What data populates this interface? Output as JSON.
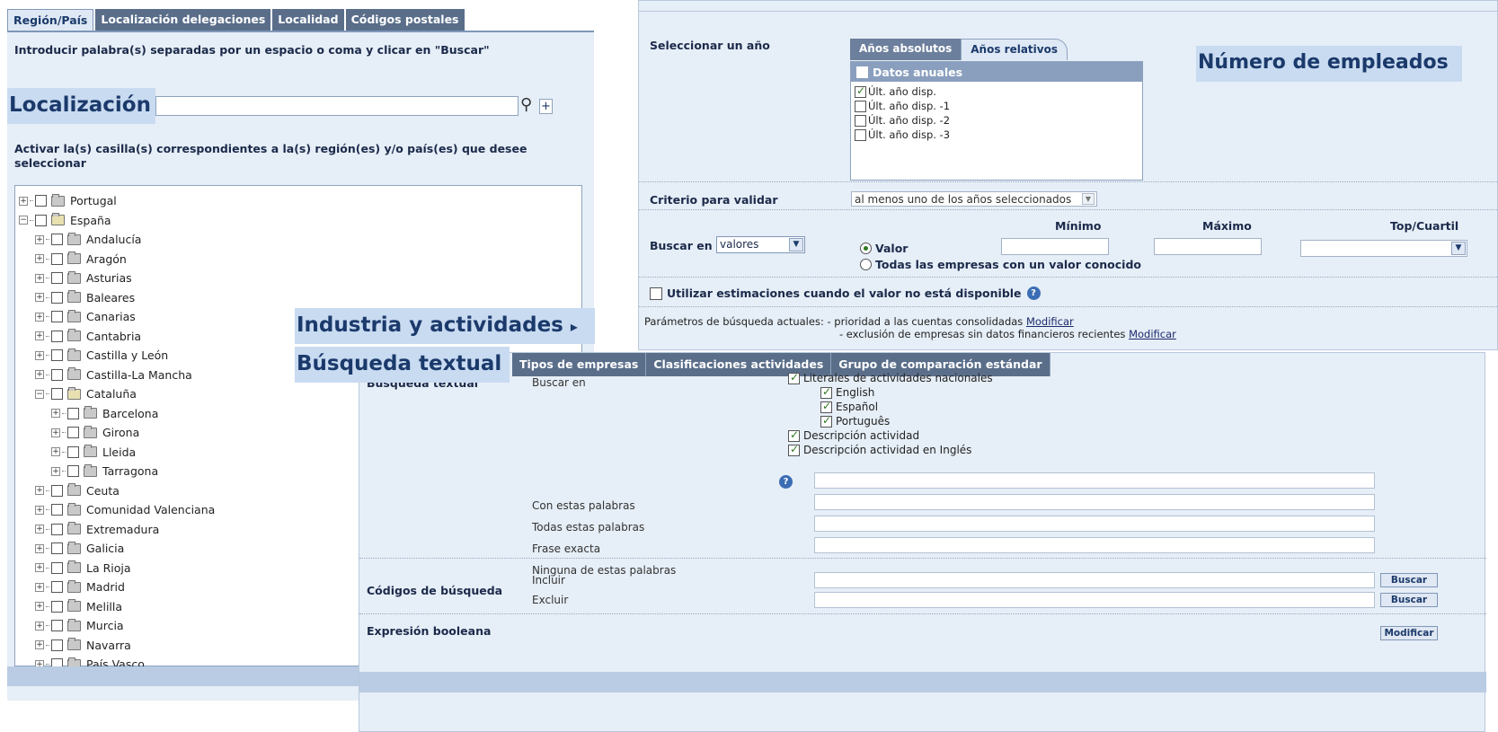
{
  "left": {
    "tabs": [
      "Región/País",
      "Localización delegaciones",
      "Localidad",
      "Códigos postales"
    ],
    "intro": "Introducir palabra(s) separadas por un espacio o coma y clicar en \"Buscar\"",
    "loc_label": "Localización",
    "plus_label": "+",
    "activar": "Activar la(s) casilla(s) correspondientes a la(s) región(es) y/o país(es) que desee seleccionar",
    "tree": [
      {
        "label": "Portugal",
        "level": 0,
        "open": false
      },
      {
        "label": "España",
        "level": 0,
        "open": true
      },
      {
        "label": "Andalucía",
        "level": 1,
        "open": false
      },
      {
        "label": "Aragón",
        "level": 1,
        "open": false
      },
      {
        "label": "Asturias",
        "level": 1,
        "open": false
      },
      {
        "label": "Baleares",
        "level": 1,
        "open": false
      },
      {
        "label": "Canarias",
        "level": 1,
        "open": false
      },
      {
        "label": "Cantabria",
        "level": 1,
        "open": false
      },
      {
        "label": "Castilla y León",
        "level": 1,
        "open": false
      },
      {
        "label": "Castilla-La Mancha",
        "level": 1,
        "open": false
      },
      {
        "label": "Cataluña",
        "level": 1,
        "open": true
      },
      {
        "label": "Barcelona",
        "level": 2,
        "open": false
      },
      {
        "label": "Girona",
        "level": 2,
        "open": false
      },
      {
        "label": "Lleida",
        "level": 2,
        "open": false
      },
      {
        "label": "Tarragona",
        "level": 2,
        "open": false
      },
      {
        "label": "Ceuta",
        "level": 1,
        "open": false
      },
      {
        "label": "Comunidad Valenciana",
        "level": 1,
        "open": false
      },
      {
        "label": "Extremadura",
        "level": 1,
        "open": false
      },
      {
        "label": "Galicia",
        "level": 1,
        "open": false
      },
      {
        "label": "La Rioja",
        "level": 1,
        "open": false
      },
      {
        "label": "Madrid",
        "level": 1,
        "open": false
      },
      {
        "label": "Melilla",
        "level": 1,
        "open": false
      },
      {
        "label": "Murcia",
        "level": 1,
        "open": false
      },
      {
        "label": "Navarra",
        "level": 1,
        "open": false
      },
      {
        "label": "País Vasco",
        "level": 1,
        "open": false
      }
    ]
  },
  "right_top": {
    "select_year": "Seleccionar un año",
    "year_tabs": [
      "Años absolutos",
      "Años relativos"
    ],
    "datos_anuales": "Datos anuales",
    "years": [
      {
        "label": "Últ. año disp.",
        "checked": true
      },
      {
        "label": "Últ. año disp. -1",
        "checked": false
      },
      {
        "label": "Últ. año disp. -2",
        "checked": false
      },
      {
        "label": "Últ. año disp. -3",
        "checked": false
      }
    ],
    "num_empleados": "Número de empleados",
    "criterio_label": "Criterio para validar",
    "criterio_value": "al menos uno de los años seleccionados",
    "col_minimo": "Mínimo",
    "col_maximo": "Máximo",
    "col_top": "Top/Cuartil",
    "buscar_en_label": "Buscar en",
    "buscar_en_value": "valores",
    "radio_valor": "Valor",
    "radio_todas": "Todas las empresas con un valor conocido",
    "estimaciones": "Utilizar estimaciones cuando el valor no está disponible",
    "params_label": "Parámetros de búsqueda actuales:",
    "param1": "- prioridad a las cuentas consolidadas",
    "param2": "- exclusión de empresas sin datos financieros recientes",
    "modificar": "Modificar"
  },
  "overlay": {
    "industria": "Industria y actividades",
    "busqueda": "Búsqueda textual"
  },
  "bottom": {
    "tabs": [
      "Tipos de empresas",
      "Clasificaciones actividades",
      "Grupo de comparación estándar"
    ],
    "busqueda_textual": "Búsqueda textual",
    "buscar_en": "Buscar en",
    "checks": [
      {
        "label": "Literales de actividades nacionales",
        "indent": 0
      },
      {
        "label": "English",
        "indent": 1
      },
      {
        "label": "Español",
        "indent": 1
      },
      {
        "label": "Português",
        "indent": 1
      },
      {
        "label": "Descripción actividad",
        "indent": 0
      },
      {
        "label": "Descripción actividad en Inglés",
        "indent": 0
      }
    ],
    "con_estas": "Con estas palabras",
    "todas_estas": "Todas estas palabras",
    "frase_exacta": "Frase exacta",
    "ninguna": "Ninguna de estas palabras",
    "codigos": "Códigos de búsqueda",
    "incluir": "Incluir",
    "excluir": "Excluir",
    "buscar_btn": "Buscar",
    "expresion": "Expresión booleana",
    "modificar_btn": "Modificar"
  },
  "colors": {
    "tab_bg": "#5a6e8a",
    "panel_bg": "#e6eef7",
    "label_bg": "#c9dbf1",
    "title_text": "#1b3a6b",
    "check_green": "#2d7a1e"
  }
}
